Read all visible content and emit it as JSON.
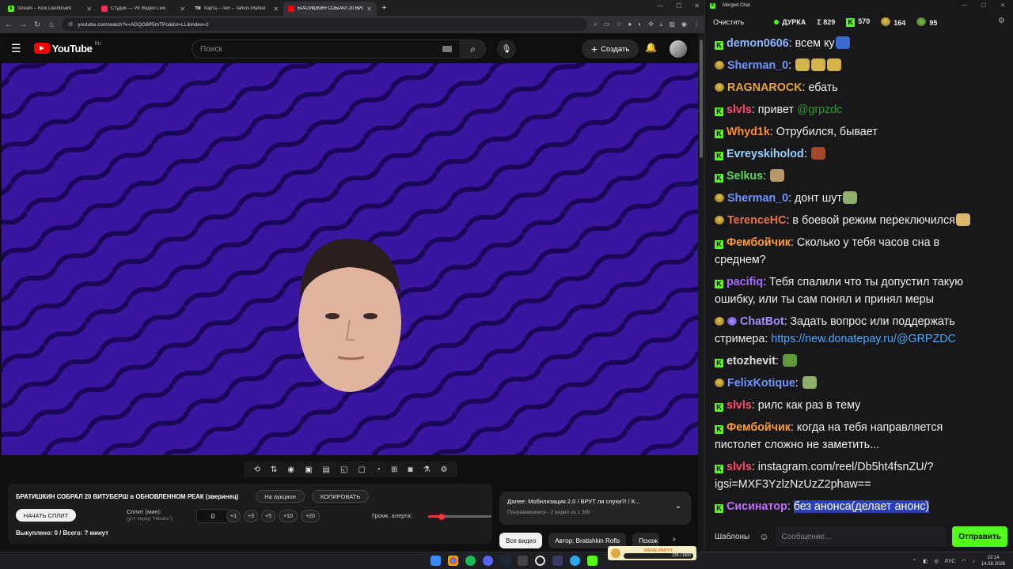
{
  "browser": {
    "tabs": [
      {
        "label": "Stream – Kick Dashboard",
        "fav_color": "#53fc18",
        "fav_text": "K"
      },
      {
        "label": "Студия — VK Видео Live",
        "fav_color": "#ff2a55",
        "fav_text": ""
      },
      {
        "label": "Карта – Лес – Tarkov Market",
        "fav_color": "#222222",
        "fav_text": "TM"
      },
      {
        "label": "БРАТИШКИН СОБРАЛ 20 ВИТ...",
        "fav_color": "#ff0000",
        "fav_text": ""
      }
    ],
    "url": "youtube.com/watch?v=ADQG8P5mTPo&list=LL&index=2"
  },
  "youtube": {
    "logo": "YouTube",
    "region": "RU",
    "search_placeholder": "Поиск",
    "create_label": "Создать"
  },
  "controls_icons": [
    "repeat-icon",
    "sort-icon",
    "broadcast-icon",
    "video-settings-icon",
    "clapper-icon",
    "pip-icon",
    "frame-icon",
    "speed-icon",
    "add-icon",
    "camera-icon",
    "flask-icon",
    "gear-icon"
  ],
  "panel": {
    "title": "БРАТИШКИН СОБРАЛ 20 ВИТУБЕРШ в ОБНОВЛЕННОМ РЕАК (зверинец)",
    "auction": "На аукцион",
    "copy": "КОПИРОВАТЬ",
    "start_split": "НАЧАТЬ СПЛИТ",
    "split_label": "Сплит (мин):",
    "split_hint": "(уст. перед \"Начать\")",
    "split_value": "0",
    "increments": [
      "+1",
      "+3",
      "+5",
      "+10",
      "+20"
    ],
    "volume_label": "Громк. алерта:",
    "volume_level": 0.2,
    "bought": "Выкуплено: 0 / Всего: ? минут"
  },
  "next": {
    "title": "Далее: Мобилизация 2.0 / ВРУТ ли слухи?! / К...",
    "subtitle": "Понравившиеся - 2 видео из 1 356"
  },
  "chips": [
    "Все видео",
    "Автор: Bratishkin Rofls",
    "Похож"
  ],
  "chat": {
    "window_title": "Merged Chat",
    "clear": "Очистить",
    "channel": "ДУРКА",
    "stats": [
      {
        "icon": "Σ",
        "value": "829"
      },
      {
        "icon": "K",
        "value": "570"
      },
      {
        "icon": "bnr",
        "value": "164"
      },
      {
        "icon": "frog",
        "value": "95"
      }
    ],
    "messages": [
      {
        "platform": "kick",
        "user": "demon0606",
        "color": "#8fb5ff",
        "text": "всем ку",
        "emotes": [
          "#3a6ad0"
        ]
      },
      {
        "platform": "bnr",
        "user": "Sherman_0",
        "color": "#6f96ff",
        "text": "",
        "emotes": [
          "#d4b44a",
          "#d4b44a",
          "#d4b44a"
        ]
      },
      {
        "platform": "bnr",
        "user": "RAGNAROCK",
        "color": "#e8a43c",
        "text": "ебать",
        "emotes": []
      },
      {
        "platform": "kick",
        "user": "slvls",
        "color": "#ff4a6a",
        "text": "привет ",
        "mention": "@grpzdc",
        "emotes": []
      },
      {
        "platform": "kick",
        "user": "Whyd1k",
        "color": "#ff8c2a",
        "text": "Отрубился, бывает",
        "emotes": []
      },
      {
        "platform": "kick",
        "user": "Evreyskiholod",
        "color": "#9ad4ff",
        "text": "",
        "emotes": [
          "#a5472a"
        ]
      },
      {
        "platform": "kick",
        "user": "Selkus",
        "color": "#5fd45f",
        "text": "",
        "emotes": [
          "#b89868"
        ]
      },
      {
        "platform": "bnr",
        "user": "Sherman_0",
        "color": "#6f96ff",
        "text": "донт шут",
        "emotes": [
          "#8fb06a"
        ]
      },
      {
        "platform": "bnr",
        "user": "TerenceHC",
        "color": "#e8734a",
        "text": "в боевой режим переключился",
        "emotes": [
          "#d8b86a"
        ]
      },
      {
        "platform": "kick",
        "user": "Фембойчик",
        "color": "#ff9b2e",
        "text": "Сколько у тебя часов сна в среднем?",
        "emotes": []
      },
      {
        "platform": "kick",
        "user": "pacifiq",
        "color": "#a46bff",
        "text": "Тебя спалили что ты допустил такую ошибку, или ты сам понял и принял меры",
        "emotes": []
      },
      {
        "platform": "bnr-bot",
        "user": "ChatBot",
        "color": "#a98bff",
        "text": "Задать вопрос или поддержать стримера: ",
        "link": "https://new.donatepay.ru/@GRPZDC",
        "emotes": []
      },
      {
        "platform": "kick",
        "user": "etozhevit",
        "color": "#e0e0e0",
        "text": "",
        "emotes": [
          "#5d9a3c"
        ]
      },
      {
        "platform": "bnr",
        "user": "FelixKotique",
        "color": "#6f96ff",
        "text": "",
        "emotes": [
          "#8fb06a"
        ]
      },
      {
        "platform": "kick",
        "user": "slvls",
        "color": "#ff4a6a",
        "text": "рилс как раз в тему",
        "emotes": []
      },
      {
        "platform": "kick",
        "user": "Фембойчик",
        "color": "#ff9b2e",
        "text": "когда на тебя направляется пистолет сложно не заметить...",
        "emotes": []
      },
      {
        "platform": "kick",
        "user": "slvls",
        "color": "#ff4a6a",
        "text": "instagram.com/reel/Db5ht4fsnZU/?igsi=MXF3YzlzNzUzZ2phaw==",
        "emotes": []
      },
      {
        "platform": "kick",
        "user": "Сисинатор",
        "color": "#c36bff",
        "text": "",
        "selected": "без анонса(делает анонс)",
        "emotes": []
      }
    ],
    "templates": "Шаблоны",
    "input_placeholder": "Сообщение...",
    "send": "Отправить"
  },
  "taskbar": {
    "widget_title": "MEME PARTY",
    "widget_value": "225 / 1500",
    "lang": "РУС",
    "time": "13:14",
    "date": "14.08.2026"
  }
}
